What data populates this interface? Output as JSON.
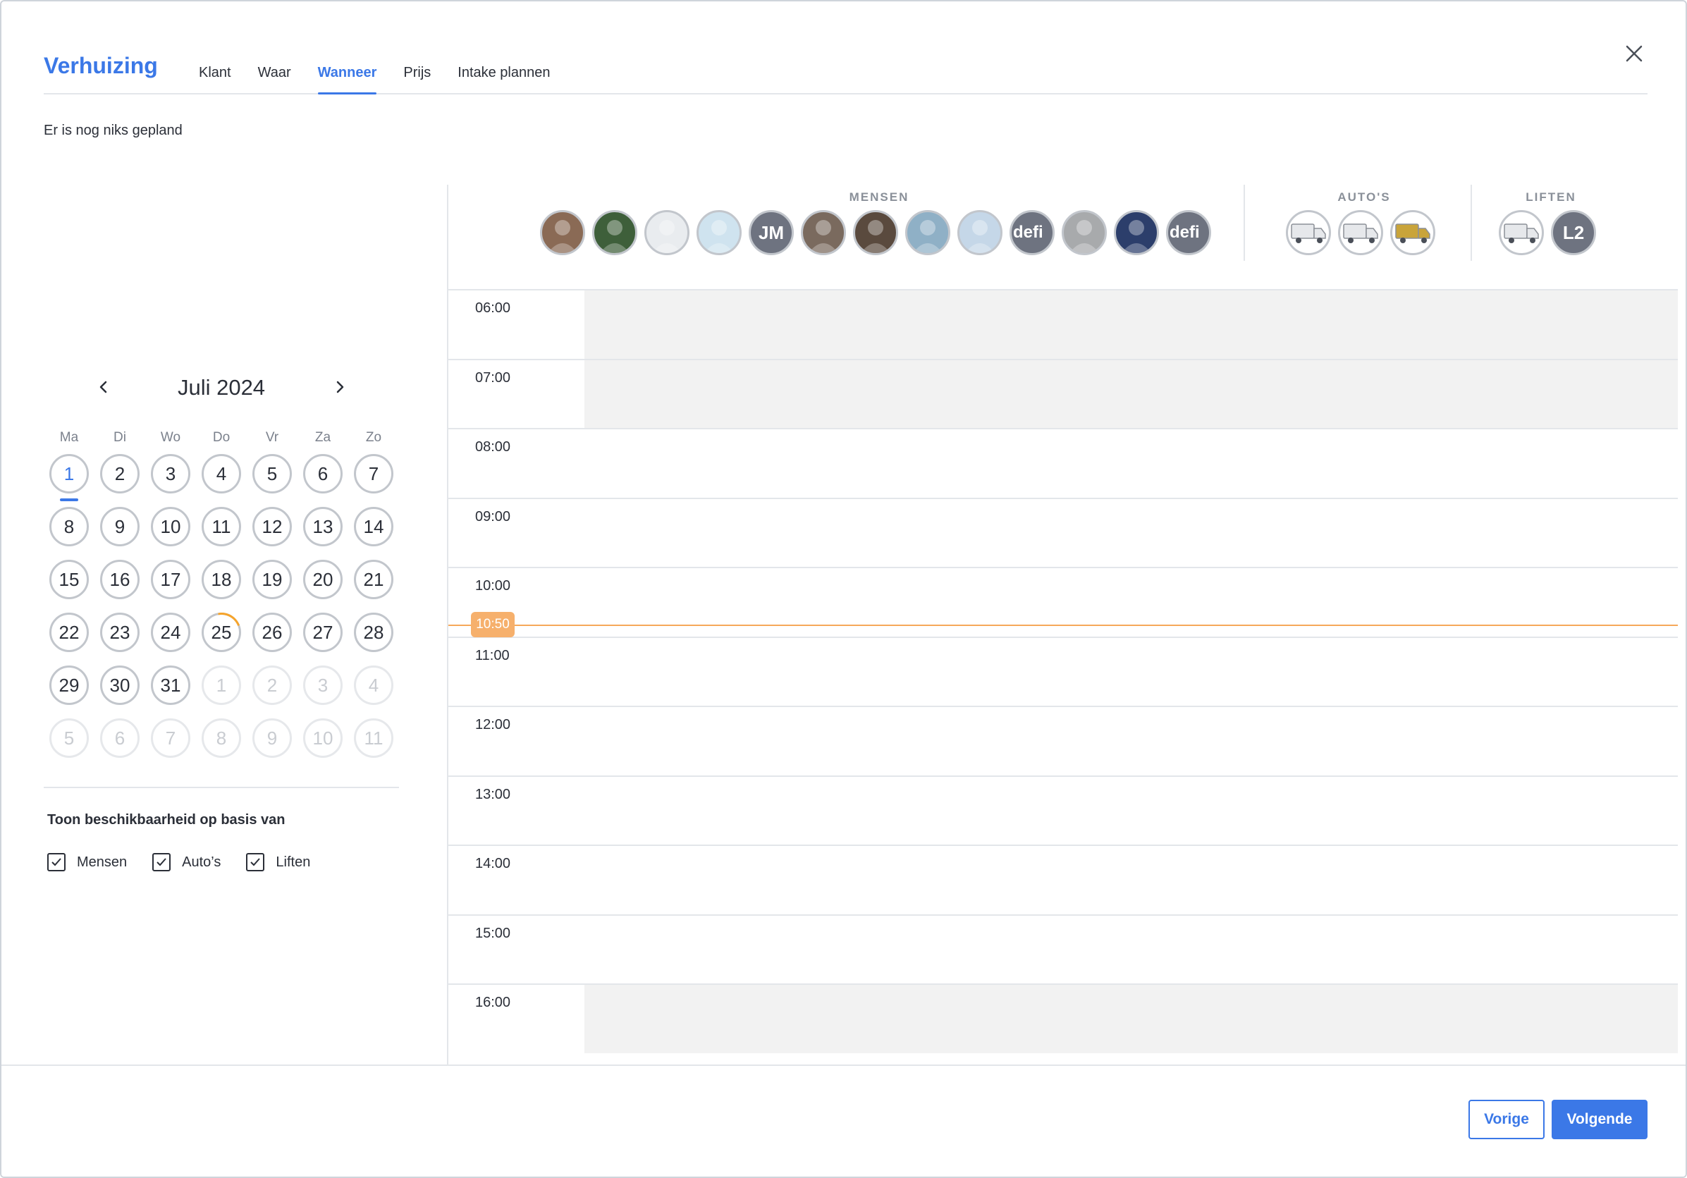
{
  "header": {
    "title": "Verhuizing",
    "tabs": [
      {
        "label": "Klant"
      },
      {
        "label": "Waar"
      },
      {
        "label": "Wanneer",
        "active": true
      },
      {
        "label": "Prijs"
      },
      {
        "label": "Intake plannen"
      }
    ]
  },
  "status": "Er is nog niks gepland",
  "calendar": {
    "month_label": "Juli 2024",
    "weekdays": [
      "Ma",
      "Di",
      "Wo",
      "Do",
      "Vr",
      "Za",
      "Zo"
    ],
    "days": [
      {
        "n": "1",
        "state": "today"
      },
      {
        "n": "2"
      },
      {
        "n": "3"
      },
      {
        "n": "4"
      },
      {
        "n": "5"
      },
      {
        "n": "6"
      },
      {
        "n": "7"
      },
      {
        "n": "8"
      },
      {
        "n": "9"
      },
      {
        "n": "10"
      },
      {
        "n": "11"
      },
      {
        "n": "12"
      },
      {
        "n": "13"
      },
      {
        "n": "14"
      },
      {
        "n": "15"
      },
      {
        "n": "16"
      },
      {
        "n": "17"
      },
      {
        "n": "18"
      },
      {
        "n": "19"
      },
      {
        "n": "20"
      },
      {
        "n": "21"
      },
      {
        "n": "22"
      },
      {
        "n": "23"
      },
      {
        "n": "24"
      },
      {
        "n": "25",
        "state": "partial"
      },
      {
        "n": "26"
      },
      {
        "n": "27"
      },
      {
        "n": "28"
      },
      {
        "n": "29"
      },
      {
        "n": "30"
      },
      {
        "n": "31"
      },
      {
        "n": "1",
        "state": "muted"
      },
      {
        "n": "2",
        "state": "muted"
      },
      {
        "n": "3",
        "state": "muted"
      },
      {
        "n": "4",
        "state": "muted"
      },
      {
        "n": "5",
        "state": "muted"
      },
      {
        "n": "6",
        "state": "muted"
      },
      {
        "n": "7",
        "state": "muted"
      },
      {
        "n": "8",
        "state": "muted"
      },
      {
        "n": "9",
        "state": "muted"
      },
      {
        "n": "10",
        "state": "muted"
      },
      {
        "n": "11",
        "state": "muted"
      }
    ]
  },
  "availability": {
    "title": "Toon beschikbaarheid op basis van",
    "options": [
      {
        "label": "Mensen",
        "checked": true
      },
      {
        "label": "Auto’s",
        "checked": true
      },
      {
        "label": "Liften",
        "checked": true
      }
    ]
  },
  "resources": {
    "groups": [
      {
        "label": "MENSEN",
        "avatars": [
          {
            "kind": "photo",
            "color": "#8a6a55"
          },
          {
            "kind": "photo",
            "color": "#3e5f3a"
          },
          {
            "kind": "photo",
            "color": "#e9ecef"
          },
          {
            "kind": "photo",
            "color": "#cfe3ef"
          },
          {
            "kind": "initials",
            "text": "JM"
          },
          {
            "kind": "photo",
            "color": "#7a6a5e"
          },
          {
            "kind": "photo",
            "color": "#5a4a3e"
          },
          {
            "kind": "photo",
            "color": "#8fb0c6"
          },
          {
            "kind": "photo",
            "color": "#c5d7e8"
          },
          {
            "kind": "initials",
            "text": "defi"
          },
          {
            "kind": "photo",
            "color": "#a8aaac"
          },
          {
            "kind": "photo",
            "color": "#2c3e6b"
          },
          {
            "kind": "initials",
            "text": "defi"
          }
        ]
      },
      {
        "label": "AUTO'S",
        "avatars": [
          {
            "kind": "truck",
            "color": "#e6e8eb"
          },
          {
            "kind": "truck",
            "color": "#e6e8eb"
          },
          {
            "kind": "truck",
            "color": "#c9a43a"
          }
        ]
      },
      {
        "label": "LIFTEN",
        "avatars": [
          {
            "kind": "truck",
            "color": "#e6e8eb"
          },
          {
            "kind": "initials",
            "text": "L2"
          }
        ]
      }
    ]
  },
  "schedule": {
    "slots": [
      {
        "time": "06:00",
        "shaded": true
      },
      {
        "time": "07:00",
        "shaded": true
      },
      {
        "time": "08:00",
        "shaded": false
      },
      {
        "time": "09:00",
        "shaded": false
      },
      {
        "time": "10:00",
        "shaded": false
      },
      {
        "time": "11:00",
        "shaded": false
      },
      {
        "time": "12:00",
        "shaded": false
      },
      {
        "time": "13:00",
        "shaded": false
      },
      {
        "time": "14:00",
        "shaded": false
      },
      {
        "time": "15:00",
        "shaded": false
      },
      {
        "time": "16:00",
        "shaded": true
      }
    ],
    "now_label": "10:50"
  },
  "footer": {
    "prev_label": "Vorige",
    "next_label": "Volgende"
  },
  "colors": {
    "accent": "#3b78e7",
    "now": "#f6a85a",
    "shade": "#f2f2f2"
  }
}
